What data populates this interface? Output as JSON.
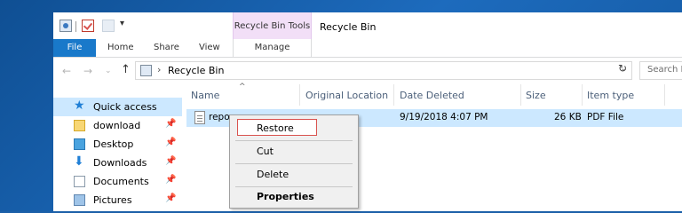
{
  "window": {
    "title": "Recycle Bin",
    "context_tab_group": "Recycle Bin Tools"
  },
  "quick_access_toolbar": {
    "dropdown_glyph": "▾"
  },
  "ribbon": {
    "tabs": [
      {
        "label": "File"
      },
      {
        "label": "Home"
      },
      {
        "label": "Share"
      },
      {
        "label": "View"
      },
      {
        "label": "Manage"
      }
    ]
  },
  "address_bar": {
    "path": "Recycle Bin",
    "search_placeholder": "Search R"
  },
  "nav_pane": {
    "items": [
      {
        "label": "Quick access",
        "icon": "star-icon"
      },
      {
        "label": "download",
        "icon": "folder-icon"
      },
      {
        "label": "Desktop",
        "icon": "desktop-icon"
      },
      {
        "label": "Downloads",
        "icon": "download-arrow-icon"
      },
      {
        "label": "Documents",
        "icon": "document-icon"
      },
      {
        "label": "Pictures",
        "icon": "pictures-icon"
      }
    ]
  },
  "file_list": {
    "columns": [
      "Name",
      "Original Location",
      "Date Deleted",
      "Size",
      "Item type"
    ],
    "rows": [
      {
        "name": "repor",
        "original_location": "",
        "date_deleted": "9/19/2018 4:07 PM",
        "size": "26 KB",
        "item_type": "PDF File"
      }
    ]
  },
  "context_menu": {
    "items": [
      "Restore",
      "Cut",
      "Delete",
      "Properties"
    ],
    "highlight_color": "#d9534f"
  },
  "colors": {
    "file_tab": "#1979ca",
    "selection": "#cce8ff",
    "context_tab": "#f2dff7"
  }
}
